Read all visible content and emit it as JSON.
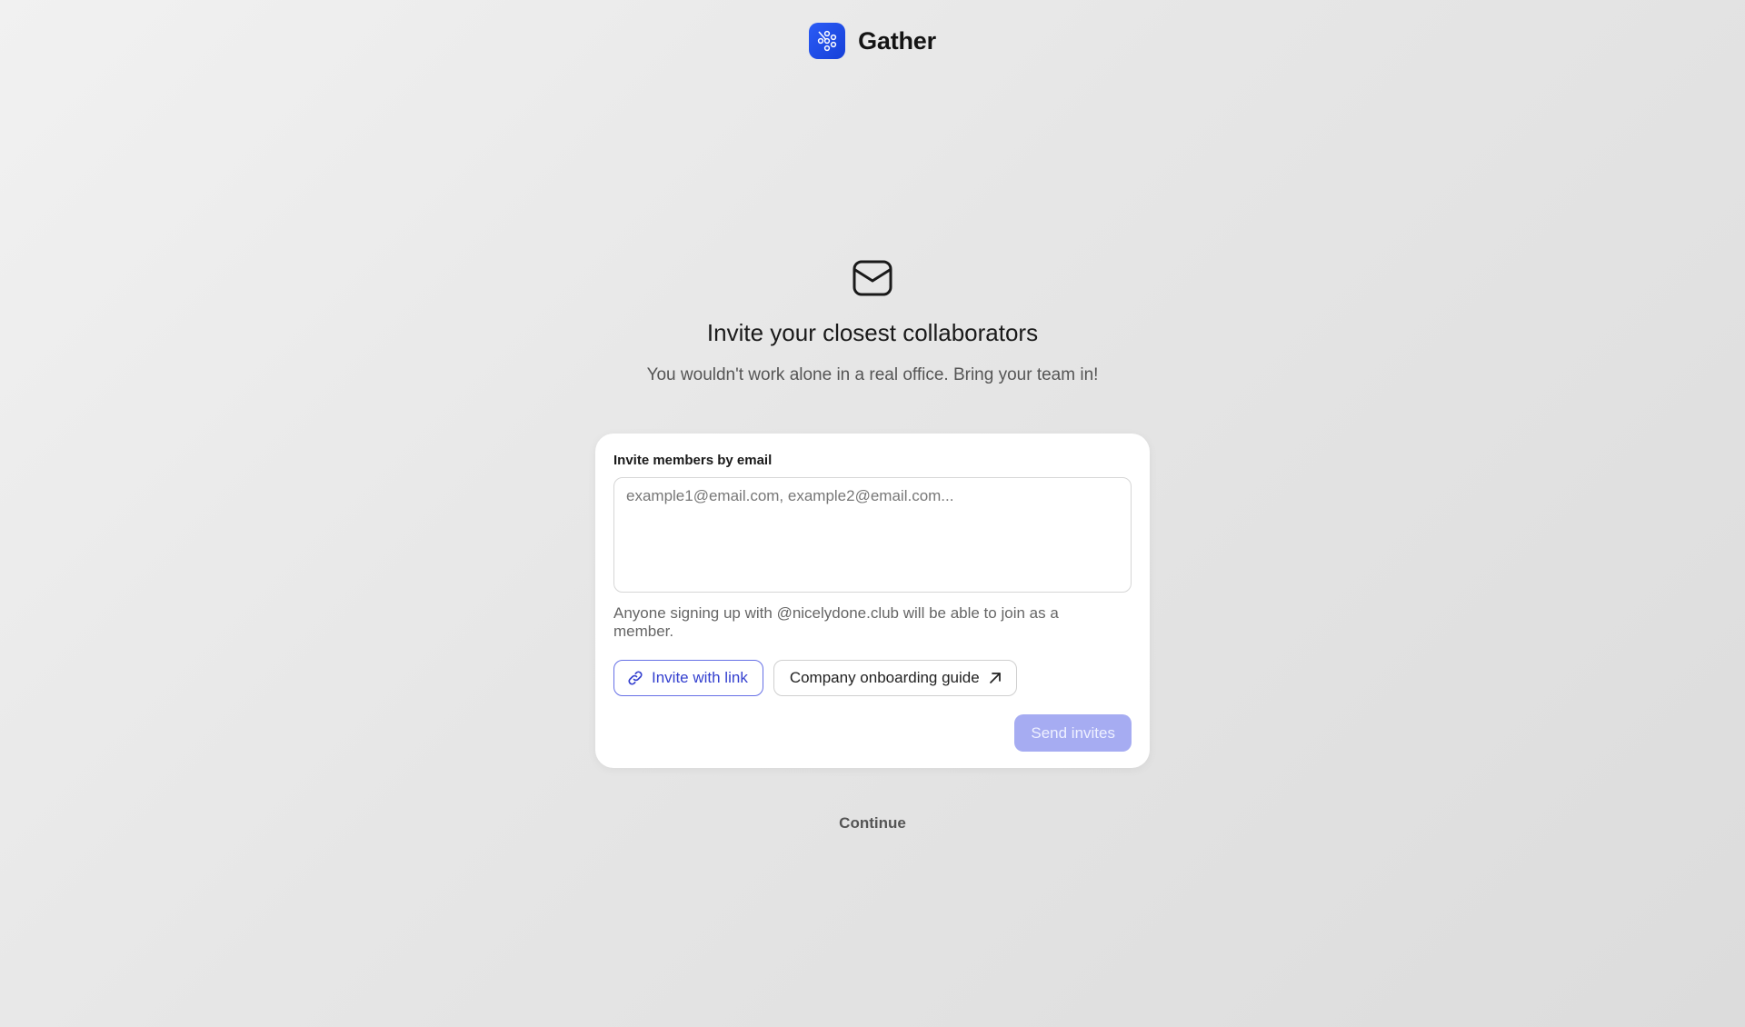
{
  "app": {
    "name": "Gather",
    "logo_icon": "gather-logo-icon",
    "brand_color": "#2b5cf6"
  },
  "hero": {
    "icon": "envelope-icon",
    "title": "Invite your closest collaborators",
    "subtitle": "You wouldn't work alone in a real office. Bring your team in!"
  },
  "invite_card": {
    "label": "Invite members by email",
    "email_input": {
      "value": "",
      "placeholder": "example1@email.com, example2@email.com..."
    },
    "hint": "Anyone signing up with @nicelydone.club will be able to join as a member.",
    "invite_link_button": {
      "label": "Invite with link",
      "icon": "link-icon",
      "color": "#3440cf"
    },
    "onboarding_guide_button": {
      "label": "Company onboarding guide",
      "icon": "arrow-up-right-icon"
    },
    "send_button": {
      "label": "Send invites",
      "state": "disabled",
      "color": "#a6acf2"
    }
  },
  "footer": {
    "continue_label": "Continue"
  }
}
